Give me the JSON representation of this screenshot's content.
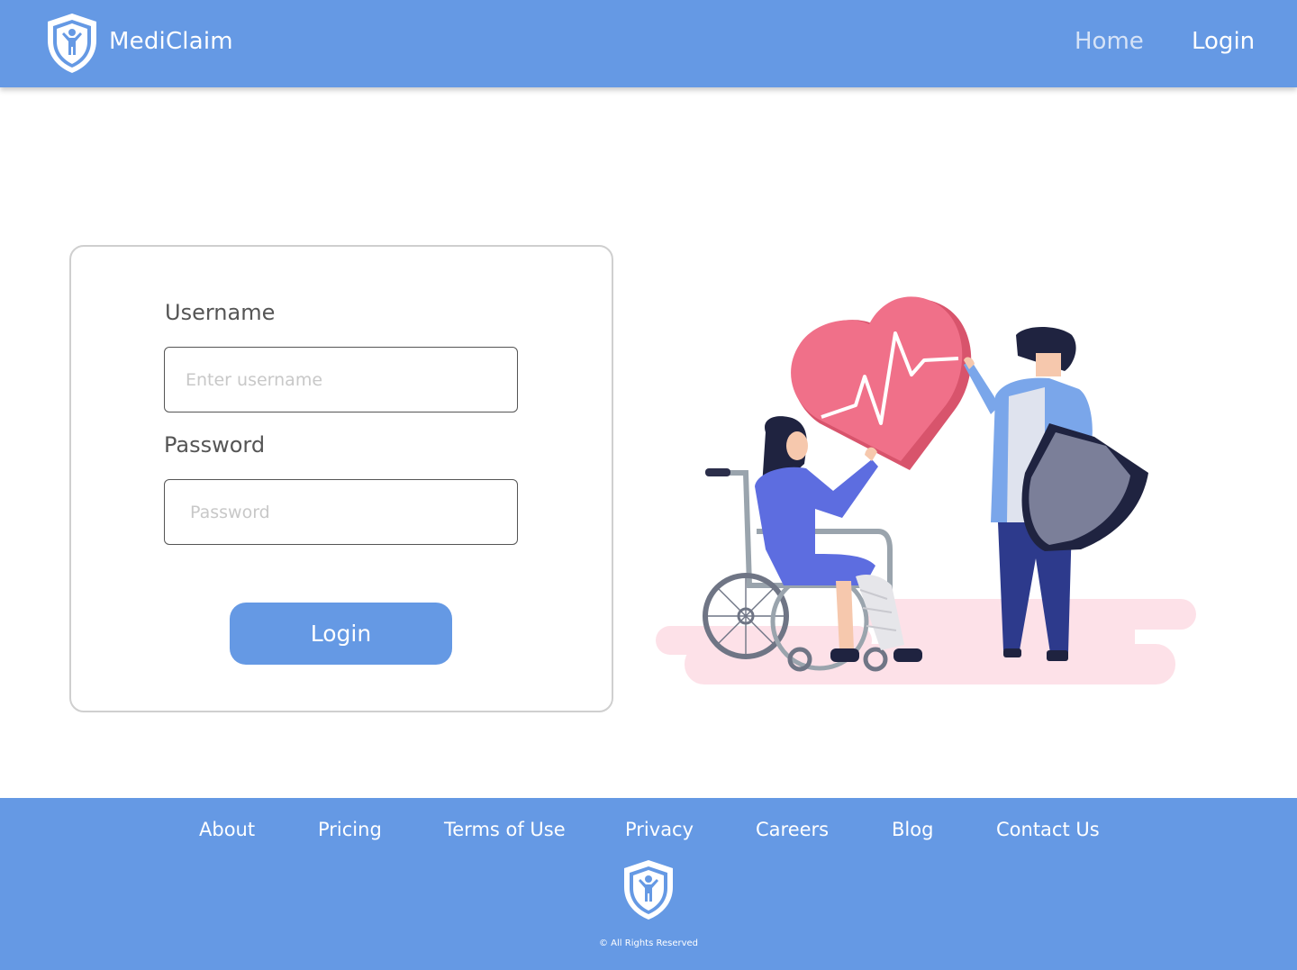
{
  "header": {
    "brand": "MediClaim",
    "logo_icon": "shield-person-icon",
    "nav": {
      "home": "Home",
      "login": "Login"
    }
  },
  "form": {
    "username_label": "Username",
    "username_placeholder": "Enter username",
    "password_label": "Password",
    "password_placeholder": "Password",
    "login_button": "Login"
  },
  "illustration": {
    "icon": "patient-wheelchair-heart-shield-illustration"
  },
  "footer": {
    "links": [
      "About",
      "Pricing",
      "Terms of Use",
      "Privacy",
      "Careers",
      "Blog",
      "Contact Us"
    ],
    "logo_icon": "shield-person-icon",
    "copyright": "© All Rights Reserved"
  },
  "colors": {
    "primary": "#6599e4",
    "heart": "#f07089",
    "navy": "#2d3a8c",
    "blush": "#fde1e8"
  }
}
